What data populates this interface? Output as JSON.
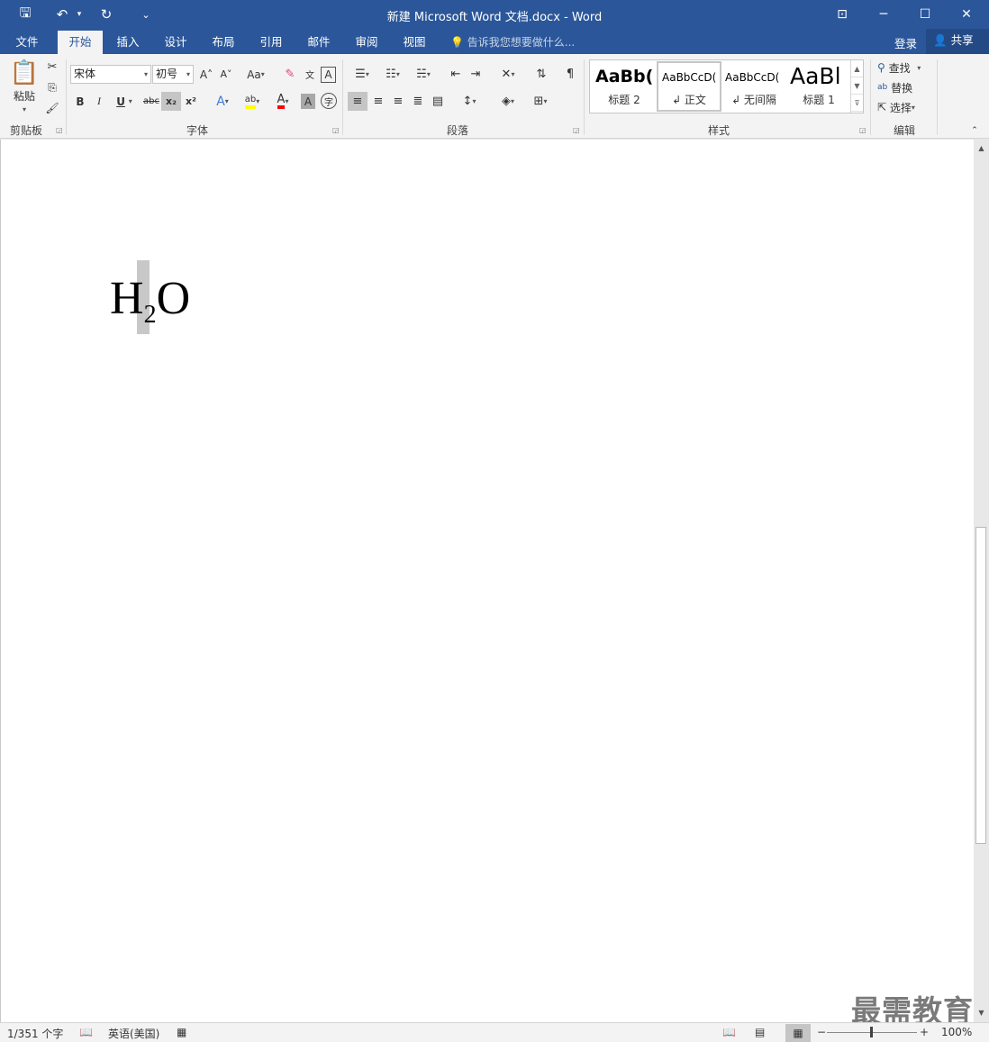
{
  "window": {
    "title": "新建 Microsoft Word 文档.docx - Word",
    "minimize": "─",
    "maximize": "☐",
    "close": "✕",
    "ribbon_display": "⊡"
  },
  "qat": {
    "save": "🖫",
    "undo": "↶",
    "undo_dd": "▾",
    "redo": "↻",
    "customize": "⌄"
  },
  "tabs": [
    "文件",
    "开始",
    "插入",
    "设计",
    "布局",
    "引用",
    "邮件",
    "审阅",
    "视图"
  ],
  "tell_me": "告诉我您想要做什么...",
  "login": "登录",
  "share": "共享",
  "clipboard": {
    "paste": "粘贴",
    "label": "剪贴板"
  },
  "font": {
    "name": "宋体",
    "size": "初号",
    "label": "字体",
    "bold": "B",
    "italic": "I",
    "underline": "U",
    "strike": "abc",
    "subscript": "x₂",
    "superscript": "x²",
    "grow": "A˄",
    "shrink": "A˅",
    "case": "Aa"
  },
  "paragraph": {
    "label": "段落"
  },
  "styles": {
    "label": "样式",
    "items": [
      {
        "sample": "AaBb(",
        "name": "标题 2"
      },
      {
        "sample": "AaBbCcD(",
        "name": "↲ 正文"
      },
      {
        "sample": "AaBbCcD(",
        "name": "↲ 无间隔"
      },
      {
        "sample": "AaBl",
        "name": "标题 1"
      }
    ]
  },
  "editing": {
    "find": "查找",
    "replace": "替换",
    "select": "选择",
    "label": "编辑"
  },
  "document": {
    "h": "H",
    "sub": "2",
    "o": "O"
  },
  "watermark": "最需教育",
  "status": {
    "page_words": "1/351 个字",
    "language": "英语(美国)",
    "zoom": "100%"
  },
  "colors": {
    "accent": "#2b579a",
    "highlight": "#ffff00",
    "font_color": "#ff0000"
  }
}
